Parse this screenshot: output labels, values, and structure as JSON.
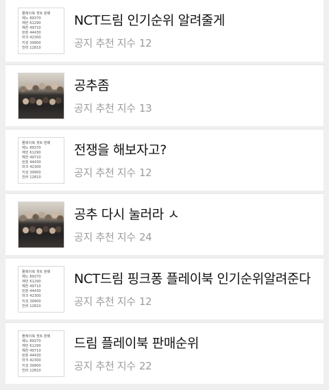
{
  "thumb_text": [
    "플레이북 셋트 판매",
    "제노 89370",
    "재민 61290",
    "해찬 49710",
    "런쥔 44430",
    "마크 42300",
    "지성 39900",
    "천러 12810"
  ],
  "posts": [
    {
      "title": "NCT드림 인기순위 알려줄게",
      "label": "공지 추천 지수",
      "count": "12",
      "thumb": "text"
    },
    {
      "title": "공추좀",
      "label": "공지 추천 지수",
      "count": "13",
      "thumb": "photo"
    },
    {
      "title": "전쟁을 해보자고?",
      "label": "공지 추천 지수",
      "count": "12",
      "thumb": "text"
    },
    {
      "title": "공추 다시 눌러라 ㅅ",
      "label": "공지 추천 지수",
      "count": "24",
      "thumb": "photo"
    },
    {
      "title": "NCT드림 핑크퐁 플레이북 인기순위알려준다",
      "label": "공지 추천 지수",
      "count": "12",
      "thumb": "text"
    },
    {
      "title": "드림 플레이북 판매순위",
      "label": "공지 추천 지수",
      "count": "22",
      "thumb": "text"
    }
  ]
}
